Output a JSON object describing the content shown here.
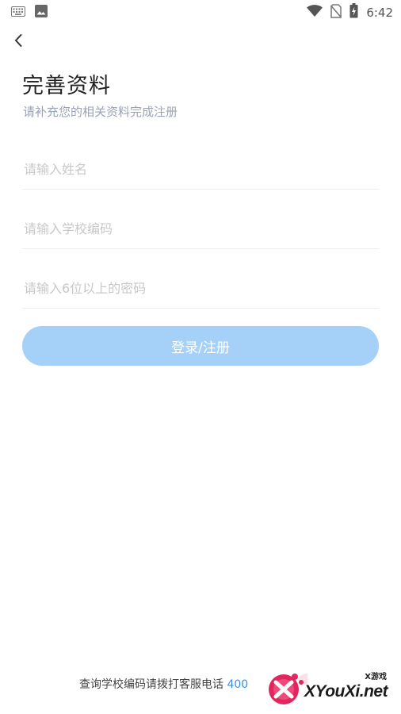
{
  "status_bar": {
    "time": "6:42",
    "left_icons": [
      "keyboard-icon",
      "image-icon"
    ],
    "right_icons": [
      "wifi-icon",
      "no-sim-icon",
      "battery-charging-icon"
    ]
  },
  "nav": {
    "back_icon": "chevron-left-icon"
  },
  "header": {
    "title": "完善资料",
    "subtitle": "请补充您的相关资料完成注册"
  },
  "form": {
    "name_placeholder": "请输入姓名",
    "school_code_placeholder": "请输入学校编码",
    "password_placeholder": "请输入6位以上的密码",
    "name_value": "",
    "school_code_value": "",
    "password_value": "",
    "submit_label": "登录/注册"
  },
  "footer": {
    "text": "查询学校编码请拨打客服电话",
    "phone_partial": "400"
  },
  "watermark": {
    "tag": "X游戏",
    "site": "XYouXi.net"
  },
  "colors": {
    "accent_button": "#a5d1f8",
    "title": "#222222",
    "subtitle": "#9aa3b5",
    "placeholder": "#c8c8c8",
    "phone_link": "#3a8ee6"
  }
}
